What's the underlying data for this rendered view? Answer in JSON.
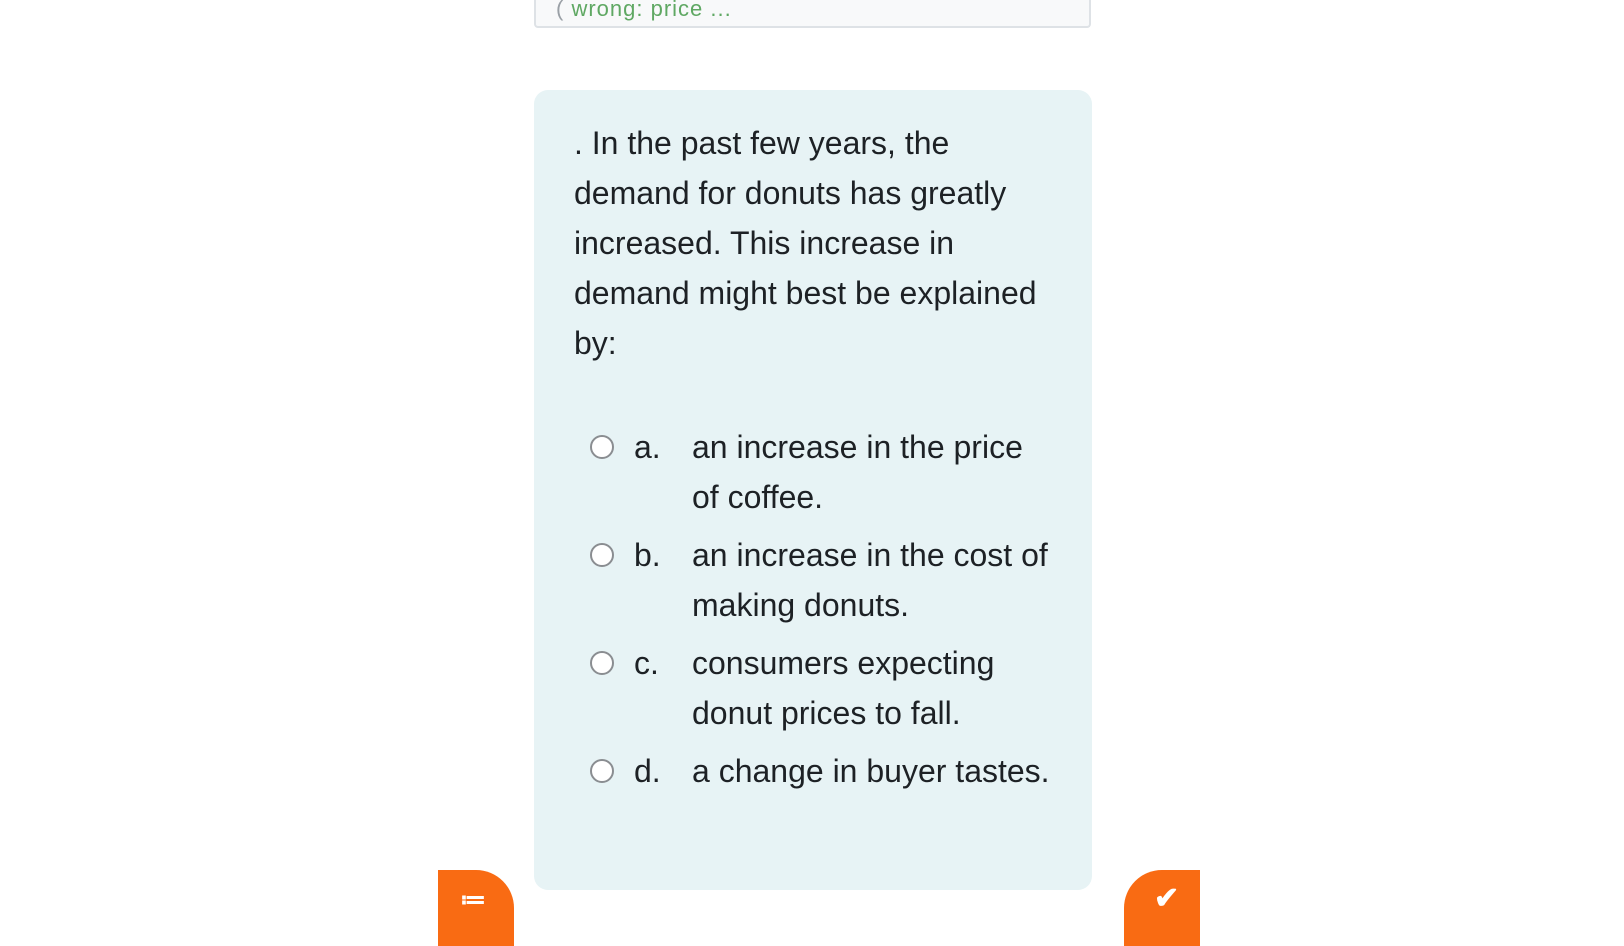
{
  "previous_card": {
    "snippet_paren": "(",
    "snippet_text": "wrong: price ..."
  },
  "question": {
    "text": ". In the past few years, the demand for donuts has greatly increased. This increase in demand might best be explained by:",
    "answers": [
      {
        "letter": "a.",
        "text": "an increase in the price of coffee."
      },
      {
        "letter": "b.",
        "text": "an increase in the cost of making donuts."
      },
      {
        "letter": "c.",
        "text": "consumers expecting donut prices to fall."
      },
      {
        "letter": "d.",
        "text": "a change in buyer tastes."
      }
    ]
  },
  "fabs": {
    "left_icon": "list-icon",
    "left_glyph": "≔",
    "right_icon": "check-icon",
    "right_glyph": "✔"
  },
  "colors": {
    "card_background": "#e7f3f5",
    "accent": "#f96b13",
    "snippet_green": "#5fa863"
  }
}
